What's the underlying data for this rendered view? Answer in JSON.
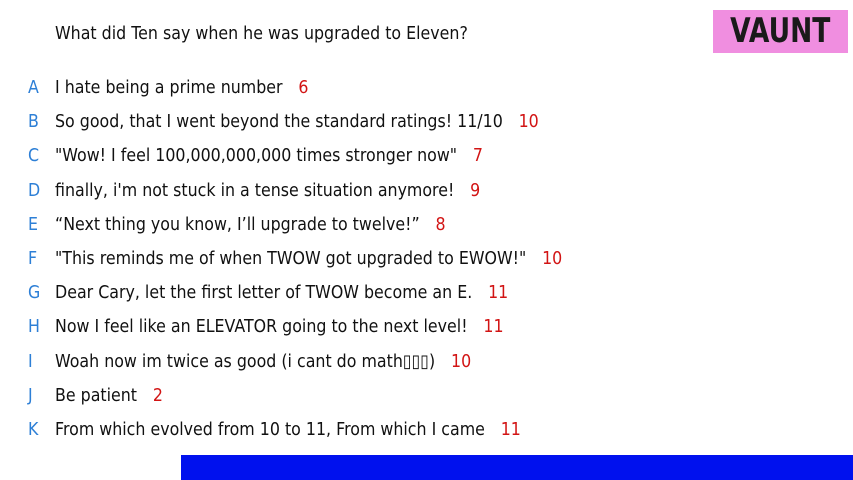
{
  "prompt": "What did Ten say when he was upgraded to Eleven?",
  "badge": {
    "label": "VAUNT",
    "color": "#f08ee0"
  },
  "colors": {
    "letter": "#2d7fd6",
    "score": "#d21414",
    "bar": "#0011ee"
  },
  "responses": [
    {
      "letter": "A",
      "text": "I hate being a prime number",
      "score": "6"
    },
    {
      "letter": "B",
      "text": "So good, that I went beyond the standard ratings! 11/10",
      "score": "10"
    },
    {
      "letter": "C",
      "text": "\"Wow! I feel 100,000,000,000 times stronger now\"",
      "score": "7"
    },
    {
      "letter": "D",
      "text": "finally, i'm not stuck in a tense situation anymore!",
      "score": "9"
    },
    {
      "letter": "E",
      "text": "“Next thing you know, I’ll upgrade to twelve!”",
      "score": "8"
    },
    {
      "letter": "F",
      "text": "\"This reminds me of when TWOW got upgraded to EWOW!\"",
      "score": "10"
    },
    {
      "letter": "G",
      "text": "Dear Cary, let the first letter of TWOW become an E.",
      "score": "11"
    },
    {
      "letter": "H",
      "text": "Now I feel like an ELEVATOR going to the next level!",
      "score": "11"
    },
    {
      "letter": "I",
      "text": "Woah now im twice as good (i cant do math▯▯▯)",
      "score": "10"
    },
    {
      "letter": "J",
      "text": "Be patient",
      "score": "2"
    },
    {
      "letter": "K",
      "text": "From which evolved from 10 to 11, From which I came",
      "score": "11"
    }
  ]
}
